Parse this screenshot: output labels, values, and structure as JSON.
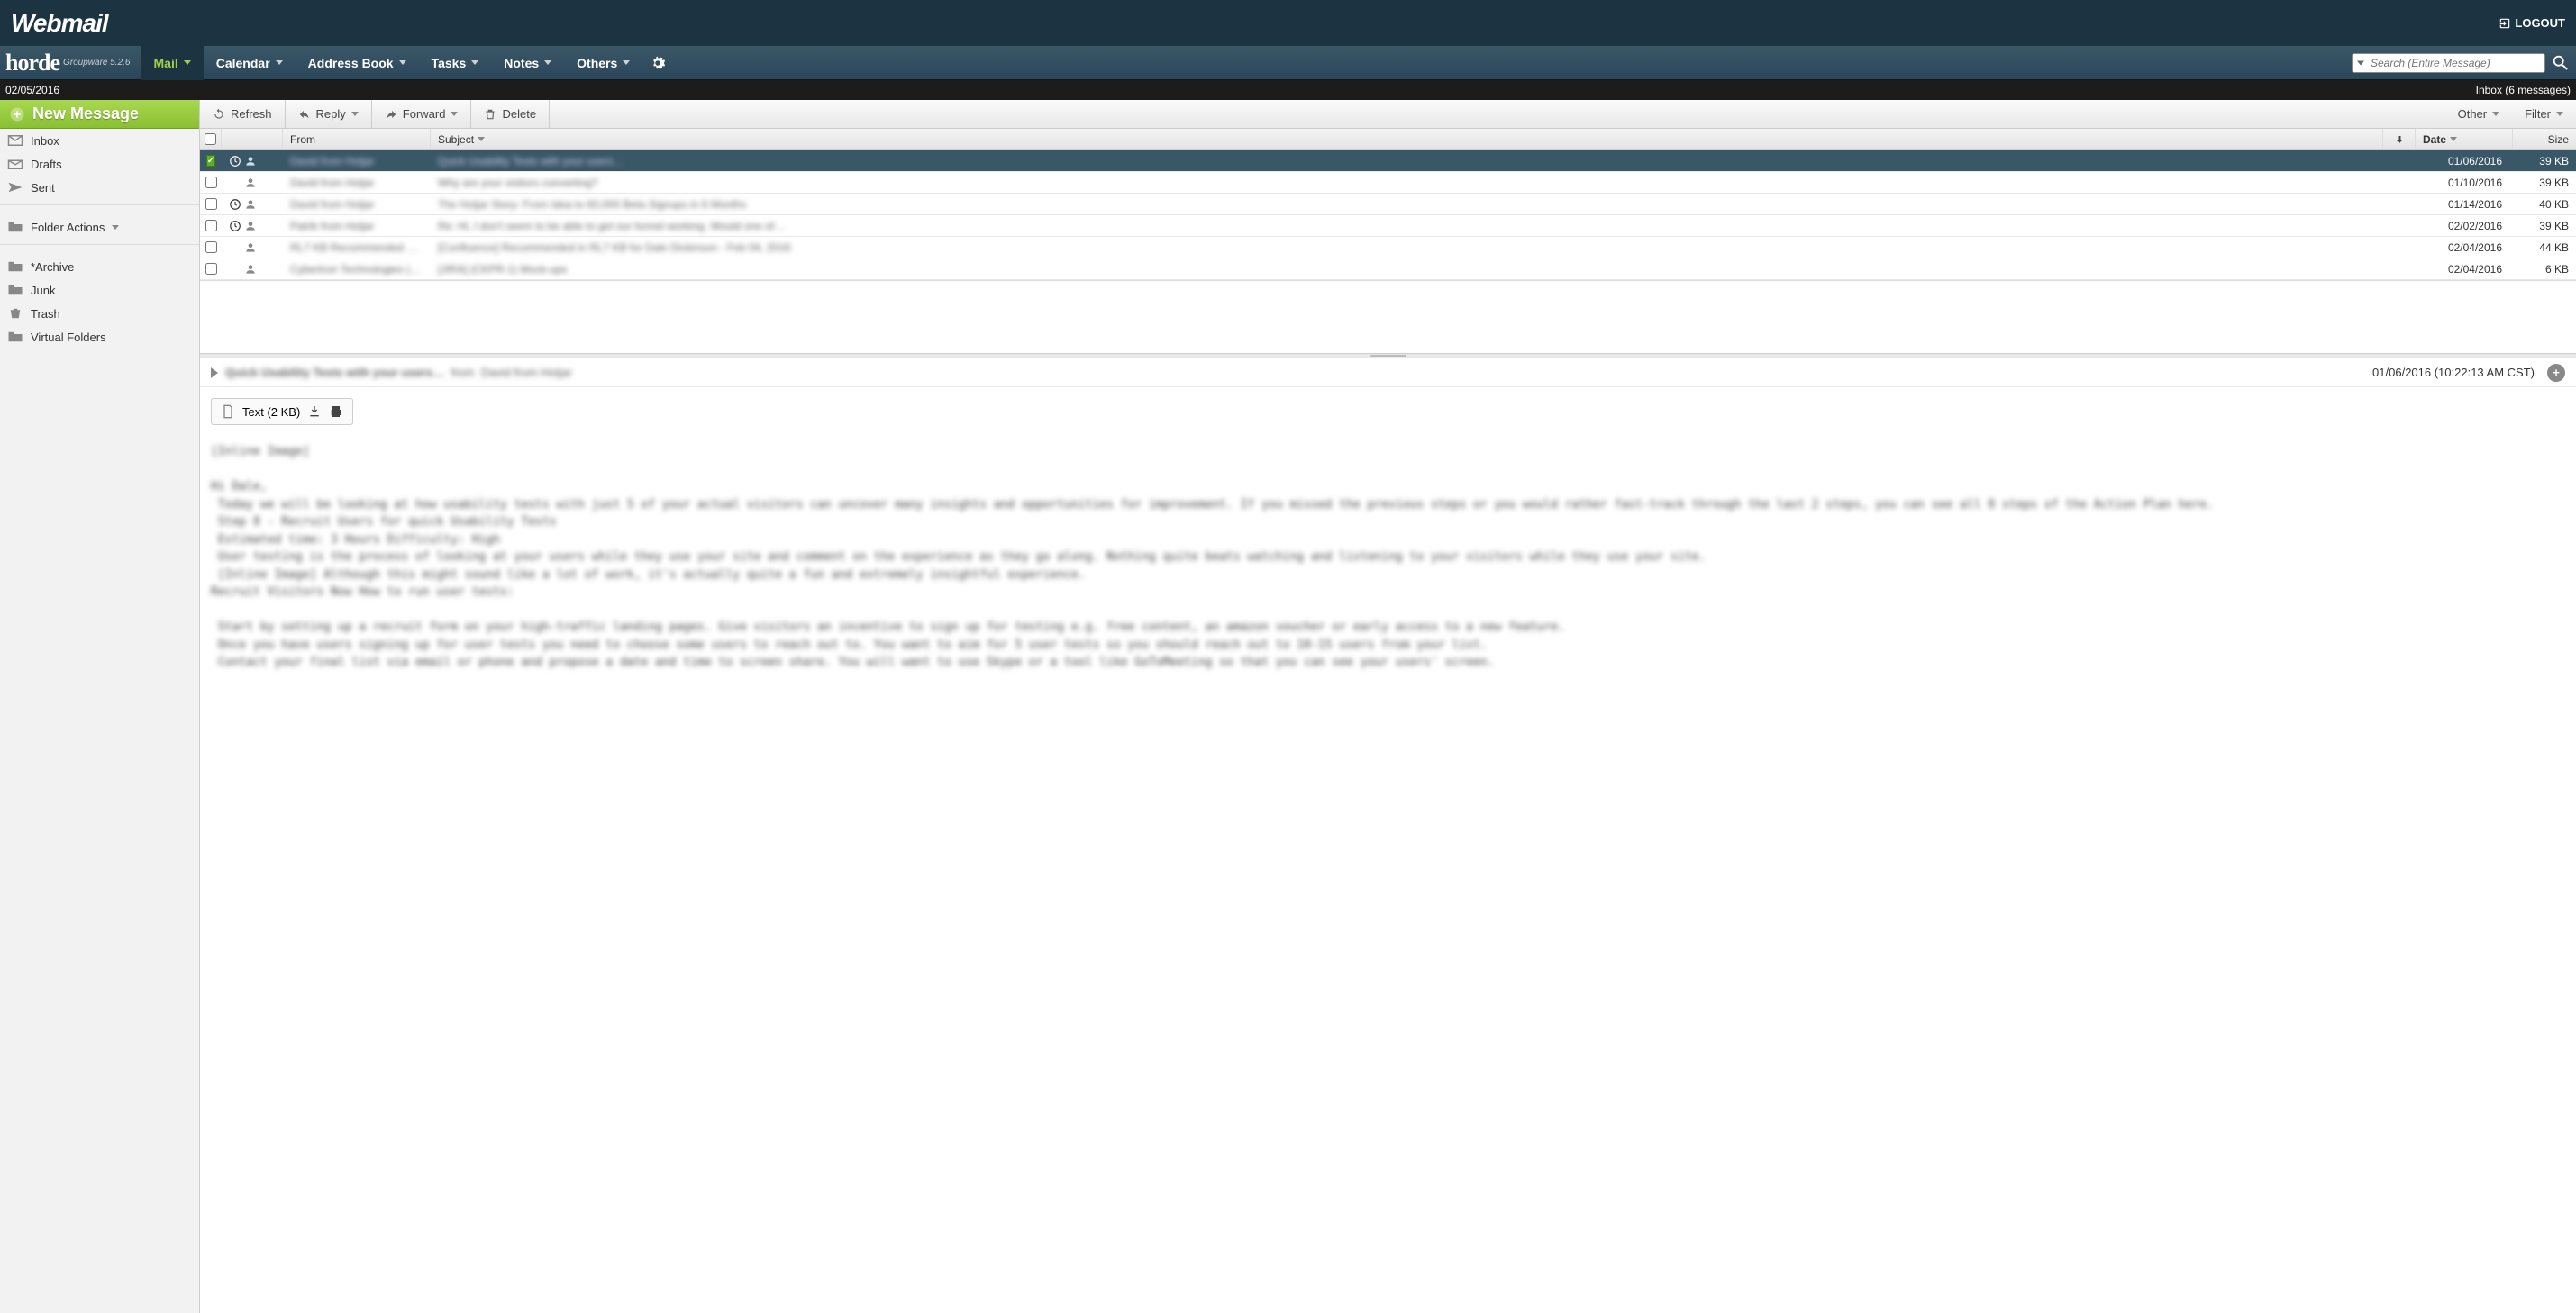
{
  "topbar": {
    "logo": "Webmail",
    "logout": "LOGOUT"
  },
  "navbar": {
    "horde": "horde",
    "horde_sub": "Groupware 5.2.6",
    "items": [
      {
        "label": "Mail",
        "active": true
      },
      {
        "label": "Calendar"
      },
      {
        "label": "Address Book"
      },
      {
        "label": "Tasks"
      },
      {
        "label": "Notes"
      },
      {
        "label": "Others"
      }
    ],
    "search_placeholder": "Search (Entire Message)"
  },
  "datebar": {
    "date": "02/05/2016",
    "inbox_status": "Inbox (6 messages)"
  },
  "sidebar": {
    "new_message": "New Message",
    "folders_top": [
      {
        "label": "Inbox",
        "icon": "inbox"
      },
      {
        "label": "Drafts",
        "icon": "drafts"
      },
      {
        "label": "Sent",
        "icon": "sent"
      }
    ],
    "folder_actions": "Folder Actions",
    "folders_bottom": [
      {
        "label": "*Archive"
      },
      {
        "label": "Junk"
      },
      {
        "label": "Trash"
      },
      {
        "label": "Virtual Folders"
      }
    ]
  },
  "toolbar": {
    "refresh": "Refresh",
    "reply": "Reply",
    "forward": "Forward",
    "delete": "Delete",
    "other": "Other",
    "filter": "Filter"
  },
  "columns": {
    "from": "From",
    "subject": "Subject",
    "date": "Date",
    "size": "Size"
  },
  "messages": [
    {
      "selected": true,
      "checked": true,
      "has_clock": true,
      "from": "David from Hotjar",
      "subject": "Quick Usability Tests with your users…",
      "date": "01/06/2016",
      "size": "39 KB"
    },
    {
      "from": "David from Hotjar",
      "subject": "Why are your visitors converting?",
      "date": "01/10/2016",
      "size": "39 KB"
    },
    {
      "has_clock": true,
      "from": "David from Hotjar",
      "subject": "The Hotjar Story: From Idea to 60,000 Beta Signups in 6 Months",
      "date": "01/14/2016",
      "size": "40 KB"
    },
    {
      "has_clock": true,
      "from": "Patrik from Hotjar",
      "subject": "Re: Hi, I don't seem to be able to get our funnel working. Would one of…",
      "date": "02/02/2016",
      "size": "39 KB"
    },
    {
      "from": "RL7 KB Recommended …",
      "subject": "[Confluence] Recommended in RL7 KB for Dale Dickinson - Feb 04, 2016",
      "date": "02/04/2016",
      "size": "44 KB"
    },
    {
      "from": "Cybertron Technologies (…",
      "subject": "[JIRA] (CKPR-1) Mock-ups",
      "date": "02/04/2016",
      "size": "6 KB"
    }
  ],
  "preview": {
    "subject": "Quick Usability Tests with your users…",
    "from_label": "from",
    "from": "David from Hotjar",
    "datetime": "01/06/2016 (10:22:13 AM CST)",
    "attachment": "Text (2 KB)",
    "body": "[Inline Image]\n\nHi Dale,\n Today we will be looking at how usability tests with just 5 of your actual visitors can uncover many insights and opportunities for improvement. If you missed the previous steps or you would rather fast-track through the last 2 steps, you can see all 8 steps of the Action Plan here.\n Step 8 - Recruit Users for quick Usability Tests\n Estimated time: 3 Hours Difficulty: High\n User testing is the process of looking at your users while they use your site and comment on the experience as they go along. Nothing quite beats watching and listening to your visitors while they use your site.\n [Inline Image] Although this might sound like a lot of work, it's actually quite a fun and extremely insightful experience.\nRecruit Visitors Now How to run user tests:\n\n Start by setting up a recruit form on your high-traffic landing pages. Give visitors an incentive to sign up for testing e.g. free content, an amazon voucher or early access to a new feature.\n Once you have users signing up for user tests you need to choose some users to reach out to. You want to aim for 5 user tests so you should reach out to 10-15 users from your list.\n Contact your final list via email or phone and propose a date and time to screen share. You will want to use Skype or a tool like GoToMeeting so that you can see your users' screen."
  }
}
